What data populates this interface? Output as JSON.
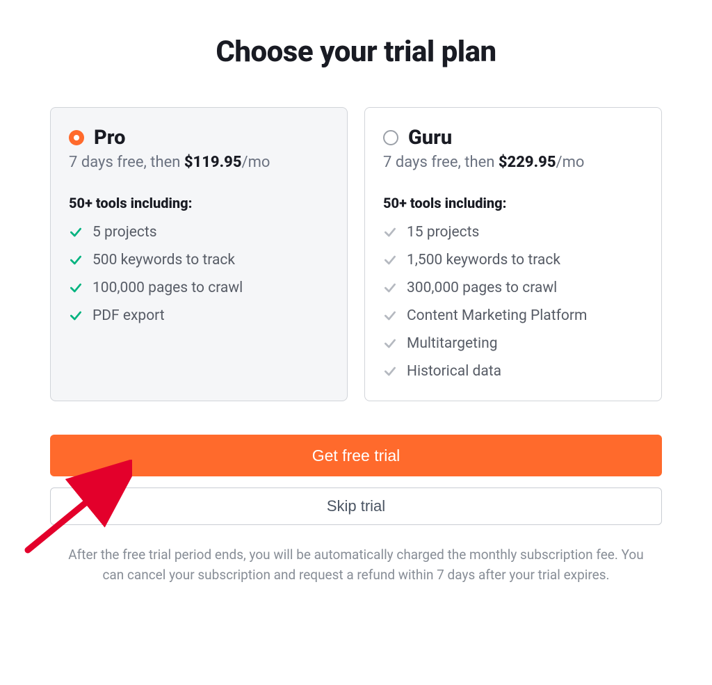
{
  "title": "Choose your trial plan",
  "plans": [
    {
      "id": "pro",
      "name": "Pro",
      "selected": true,
      "price_prefix": "7 days free, then ",
      "price": "$119.95",
      "price_suffix": "/mo",
      "tools_title": "50+ tools including:",
      "features": [
        "5 projects",
        "500 keywords to track",
        "100,000 pages to crawl",
        "PDF export"
      ],
      "check_color": "#00b37f"
    },
    {
      "id": "guru",
      "name": "Guru",
      "selected": false,
      "price_prefix": "7 days free, then ",
      "price": "$229.95",
      "price_suffix": "/mo",
      "tools_title": "50+ tools including:",
      "features": [
        "15 projects",
        "1,500 keywords to track",
        "300,000 pages to crawl",
        "Content Marketing Platform",
        "Multitargeting",
        "Historical data"
      ],
      "check_color": "#b5b9c0"
    }
  ],
  "buttons": {
    "primary": "Get free trial",
    "secondary": "Skip trial"
  },
  "disclaimer": "After the free trial period ends, you will be automatically charged the monthly subscription fee. You can cancel your subscription and request a refund within 7 days after your trial expires.",
  "annotation": {
    "arrow_target": "skip-trial-button",
    "arrow_color": "#e3002b"
  }
}
